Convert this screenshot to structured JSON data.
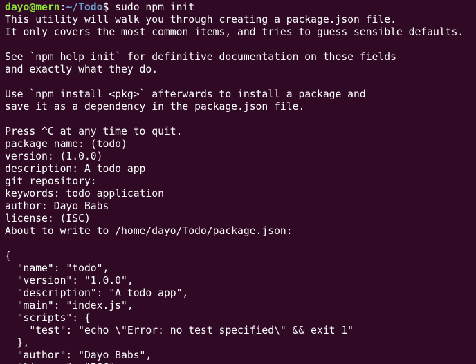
{
  "prompt": {
    "user_host": "dayo@mern",
    "separator": ":",
    "path": "~/Todo",
    "symbol": "$",
    "command": " sudo npm init"
  },
  "colors": {
    "background": "#300a24",
    "text": "#ffffff",
    "prompt_user": "#8ae234",
    "prompt_path": "#729fcf"
  },
  "output_lines": [
    "This utility will walk you through creating a package.json file.",
    "It only covers the most common items, and tries to guess sensible defaults.",
    "",
    "See `npm help init` for definitive documentation on these fields",
    "and exactly what they do.",
    "",
    "Use `npm install <pkg>` afterwards to install a package and",
    "save it as a dependency in the package.json file.",
    "",
    "Press ^C at any time to quit.",
    "package name: (todo)",
    "version: (1.0.0)",
    "description: A todo app",
    "git repository:",
    "keywords: todo application",
    "author: Dayo Babs",
    "license: (ISC)",
    "About to write to /home/dayo/Todo/package.json:",
    "",
    "{",
    "  \"name\": \"todo\",",
    "  \"version\": \"1.0.0\",",
    "  \"description\": \"A todo app\",",
    "  \"main\": \"index.js\",",
    "  \"scripts\": {",
    "    \"test\": \"echo \\\"Error: no test specified\\\" && exit 1\"",
    "  },",
    "  \"author\": \"Dayo Babs\",",
    "  \"license\": \"ISC\""
  ]
}
